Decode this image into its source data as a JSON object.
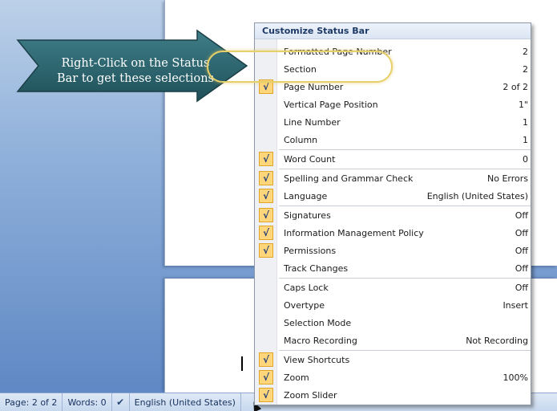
{
  "callout": {
    "text_line1": "Right-Click on the Status",
    "text_line2": "Bar to get these selections"
  },
  "status_bar": {
    "page": "Page: 2 of 2",
    "words": "Words: 0",
    "language": "English (United States)"
  },
  "menu": {
    "title": "Customize Status Bar",
    "items": [
      {
        "label": "Formatted Page Number",
        "value": "2",
        "checked": false
      },
      {
        "label": "Section",
        "value": "2",
        "checked": false
      },
      {
        "label": "Page Number",
        "value": "2 of 2",
        "checked": true
      },
      {
        "label": "Vertical Page Position",
        "value": "1\"",
        "checked": false
      },
      {
        "label": "Line Number",
        "value": "1",
        "checked": false
      },
      {
        "label": "Column",
        "value": "1",
        "checked": false
      },
      {
        "label": "Word Count",
        "value": "0",
        "checked": true
      },
      {
        "label": "Spelling and Grammar Check",
        "value": "No Errors",
        "checked": true
      },
      {
        "label": "Language",
        "value": "English (United States)",
        "checked": true
      },
      {
        "label": "Signatures",
        "value": "Off",
        "checked": true
      },
      {
        "label": "Information Management Policy",
        "value": "Off",
        "checked": true
      },
      {
        "label": "Permissions",
        "value": "Off",
        "checked": true
      },
      {
        "label": "Track Changes",
        "value": "Off",
        "checked": false
      },
      {
        "label": "Caps Lock",
        "value": "Off",
        "checked": false
      },
      {
        "label": "Overtype",
        "value": "Insert",
        "checked": false
      },
      {
        "label": "Selection Mode",
        "value": "",
        "checked": false
      },
      {
        "label": "Macro Recording",
        "value": "Not Recording",
        "checked": false
      },
      {
        "label": "View Shortcuts",
        "value": "",
        "checked": true
      },
      {
        "label": "Zoom",
        "value": "100%",
        "checked": true
      },
      {
        "label": "Zoom Slider",
        "value": "",
        "checked": true
      }
    ]
  },
  "icons": {
    "checkmark": "√",
    "proofing": "✔"
  },
  "colors": {
    "arrow_fill": "#2f6a73",
    "check_bg": "#ffd67a",
    "highlight": "#e7cf6a"
  }
}
